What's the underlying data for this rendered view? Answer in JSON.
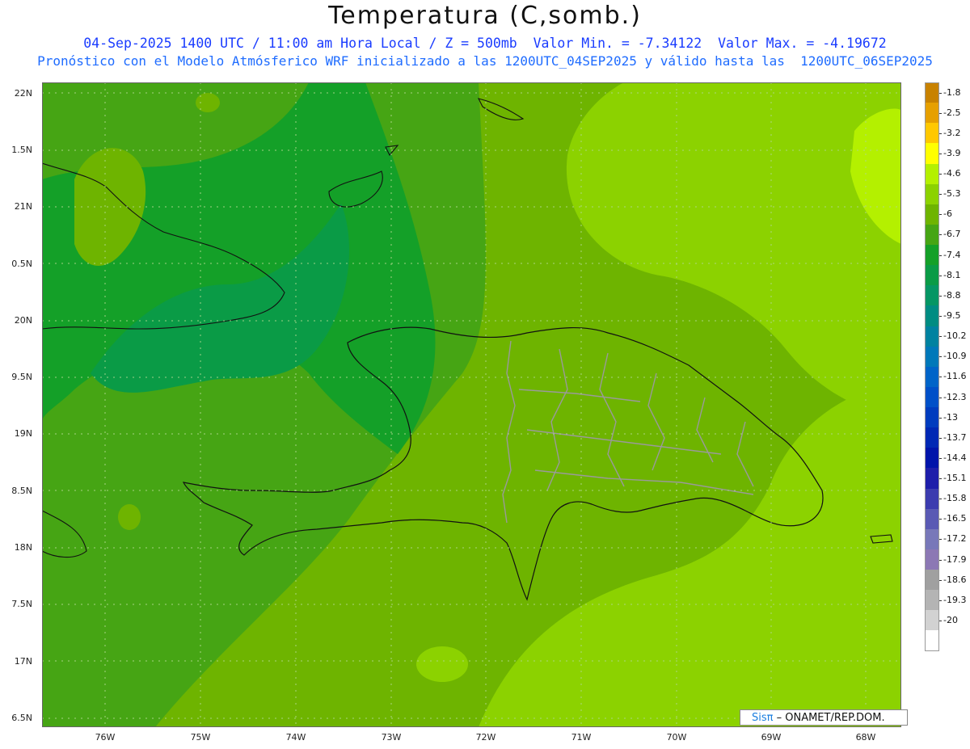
{
  "header": {
    "title": "Temperatura (C,somb.)",
    "line1": "04-Sep-2025 1400 UTC / 11:00 am Hora Local / Z = 500mb  Valor Min. = -7.34122  Valor Max. = -4.19672",
    "line2": "Pronóstico con el Modelo Atmósferico WRF inicializado a las 1200UTC_04SEP2025 y válido hasta las  1200UTC_06SEP2025"
  },
  "axes": {
    "lat_labels": [
      "22N",
      "1.5N",
      "21N",
      "0.5N",
      "20N",
      "9.5N",
      "19N",
      "8.5N",
      "18N",
      "7.5N",
      "17N",
      "6.5N"
    ],
    "lon_labels": [
      "76W",
      "75W",
      "74W",
      "73W",
      "72W",
      "71W",
      "70W",
      "69W",
      "68W"
    ]
  },
  "legend": {
    "levels": [
      {
        "label": "-1.8",
        "color": "#c88200"
      },
      {
        "label": "-2.5",
        "color": "#e6a000"
      },
      {
        "label": "-3.2",
        "color": "#ffc800"
      },
      {
        "label": "-3.9",
        "color": "#ffff00"
      },
      {
        "label": "-4.6",
        "color": "#b4f000"
      },
      {
        "label": "-5.3",
        "color": "#8cd200"
      },
      {
        "label": "-6",
        "color": "#6eb400"
      },
      {
        "label": "-6.7",
        "color": "#46a514"
      },
      {
        "label": "-7.4",
        "color": "#14a028"
      },
      {
        "label": "-8.1",
        "color": "#0a9b46"
      },
      {
        "label": "-8.8",
        "color": "#059664"
      },
      {
        "label": "-9.5",
        "color": "#008c82"
      },
      {
        "label": "-10.2",
        "color": "#0082a0"
      },
      {
        "label": "-10.9",
        "color": "#0078b9"
      },
      {
        "label": "-11.6",
        "color": "#0064c8"
      },
      {
        "label": "-12.3",
        "color": "#0050c8"
      },
      {
        "label": "-13",
        "color": "#003cbe"
      },
      {
        "label": "-13.7",
        "color": "#0028b4"
      },
      {
        "label": "-14.4",
        "color": "#0014aa"
      },
      {
        "label": "-15.1",
        "color": "#1e1eaa"
      },
      {
        "label": "-15.8",
        "color": "#3c3caf"
      },
      {
        "label": "-16.5",
        "color": "#5a5ab4"
      },
      {
        "label": "-17.2",
        "color": "#7878b9"
      },
      {
        "label": "-17.9",
        "color": "#8c78b4"
      },
      {
        "label": "-18.6",
        "color": "#a0a0a0"
      },
      {
        "label": "-19.3",
        "color": "#b4b4b4"
      },
      {
        "label": "-20",
        "color": "#d2d2d2"
      },
      {
        "label": "",
        "color": "#ffffff"
      }
    ]
  },
  "credit": {
    "brand": "Sisπ",
    "text": " – ONAMET/REP.DOM."
  }
}
